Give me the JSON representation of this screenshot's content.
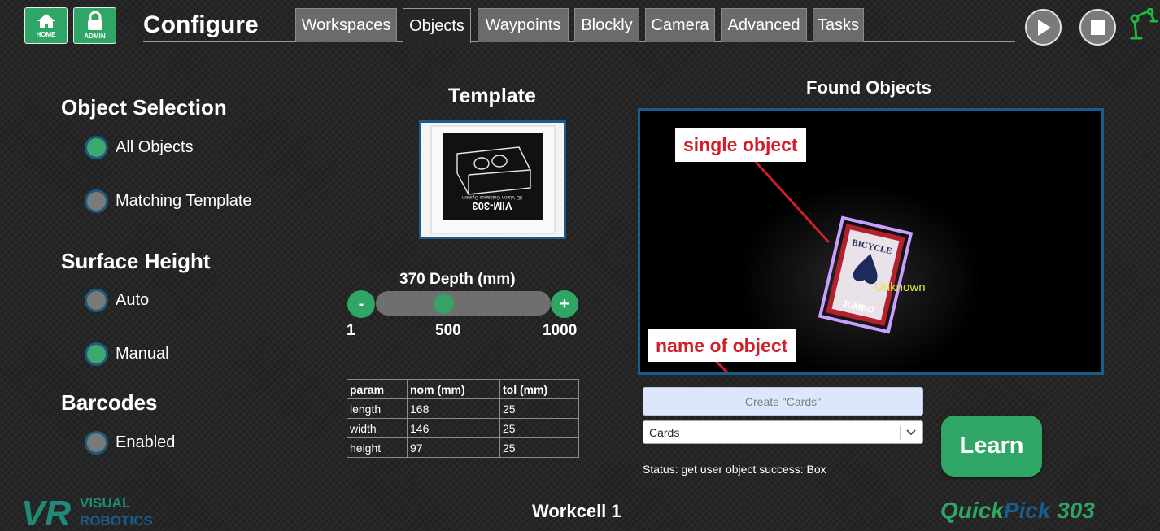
{
  "header": {
    "home_label": "HOME",
    "admin_label": "ADMIN",
    "title": "Configure",
    "tabs": [
      {
        "label": "Workspaces"
      },
      {
        "label": "Objects"
      },
      {
        "label": "Waypoints"
      },
      {
        "label": "Blockly"
      },
      {
        "label": "Camera"
      },
      {
        "label": "Advanced"
      },
      {
        "label": "Tasks"
      }
    ],
    "active_tab": "Objects",
    "icons": [
      "home-icon",
      "lock-icon",
      "play-icon",
      "stop-icon",
      "robot-arm-icon"
    ]
  },
  "object_selection": {
    "heading": "Object Selection",
    "options": [
      {
        "label": "All Objects",
        "checked": true
      },
      {
        "label": "Matching Template",
        "checked": false
      }
    ]
  },
  "surface_height": {
    "heading": "Surface Height",
    "options": [
      {
        "label": "Auto",
        "checked": false
      },
      {
        "label": "Manual",
        "checked": true
      }
    ]
  },
  "barcodes": {
    "heading": "Barcodes",
    "options": [
      {
        "label": "Enabled",
        "checked": false
      }
    ]
  },
  "template": {
    "heading": "Template",
    "box_text": "VIM-303",
    "box_subtext": "3D Vision Guidance System"
  },
  "depth": {
    "label": "370 Depth (mm)",
    "min_label": "1",
    "mid_label": "500",
    "max_label": "1000",
    "minus": "-",
    "plus": "+",
    "value": 370,
    "min": 1,
    "max": 1000
  },
  "params_table": {
    "headers": [
      "param",
      "nom (mm)",
      "tol (mm)"
    ],
    "rows": [
      [
        "length",
        "168",
        "25"
      ],
      [
        "width",
        "146",
        "25"
      ],
      [
        "height",
        "97",
        "25"
      ]
    ]
  },
  "found_objects": {
    "heading": "Found Objects",
    "detection_label": "Unknown",
    "card_top_text": "BICYCLE",
    "card_bottom_text": "JUMBO",
    "callout_single": "single object",
    "callout_name": "name of object"
  },
  "create_button": "Create \"Cards\"",
  "object_select": {
    "value": "Cards"
  },
  "learn_button": "Learn",
  "status": "Status: get user object success: Box",
  "footer": {
    "logo_top": "VISUAL",
    "logo_bottom": "ROBOTICS",
    "logo_mark": "VR",
    "workcell": "Workcell 1",
    "product_quick": "Quick",
    "product_pick": "Pick",
    "product_num": "303"
  },
  "colors": {
    "accent_green": "#2fa566",
    "border_blue": "#1a5c8c",
    "callout_red": "#d01f2a",
    "product_teal": "#1f8a7a",
    "product_green": "#2fa566",
    "logo_blue": "#1a5c8c"
  }
}
